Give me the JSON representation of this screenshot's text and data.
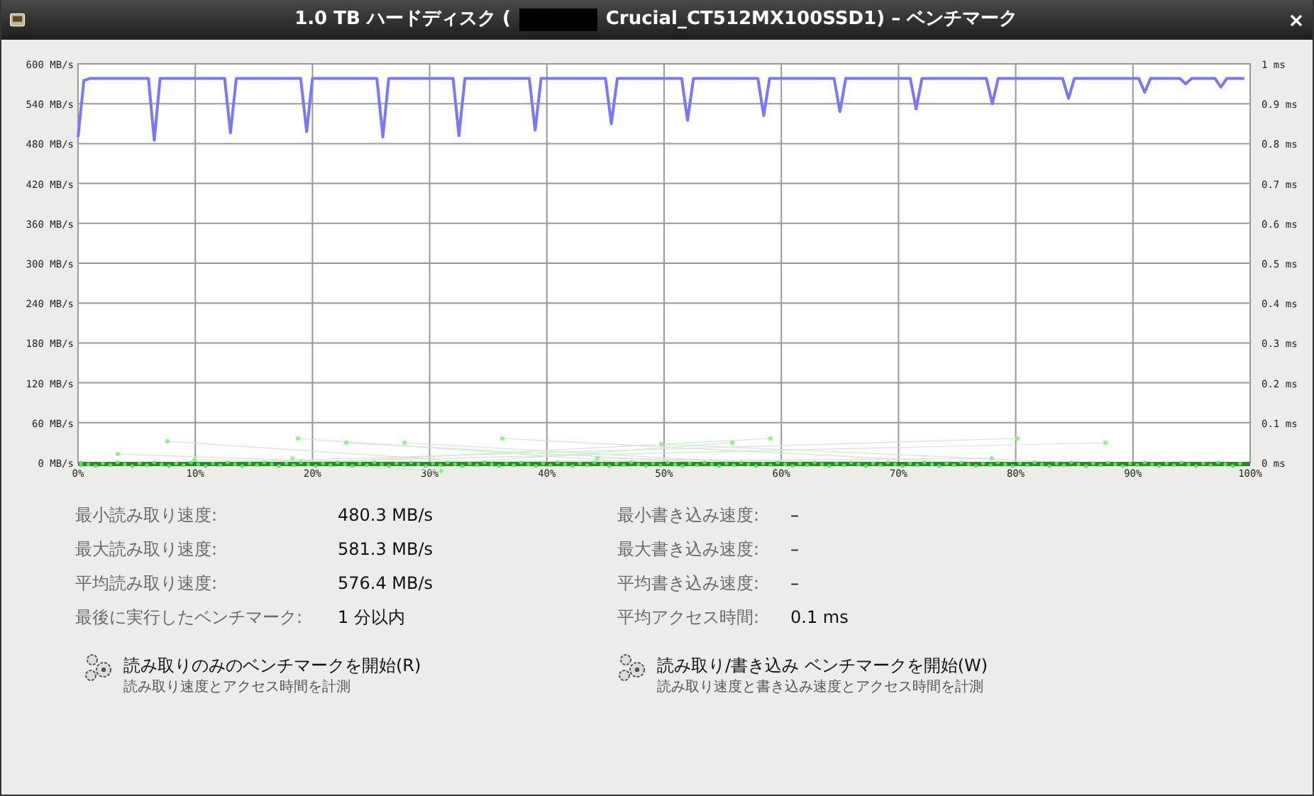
{
  "window": {
    "title_before": "1.0 TB ハードディスク (",
    "title_after": "Crucial_CT512MX100SSD1) – ベンチマーク"
  },
  "chart": {
    "right_axis_ticks": [
      "1 ms",
      "0.9 ms",
      "0.8 ms",
      "0.7 ms",
      "0.6 ms",
      "0.5 ms",
      "0.4 ms",
      "0.3 ms",
      "0.2 ms",
      "0.1 ms",
      "0 ms"
    ],
    "chart_data": {
      "type": "line",
      "grid": true,
      "xlim": [
        0,
        100
      ],
      "ylim": [
        0,
        600
      ],
      "xticks": [
        {
          "value": 0,
          "label": "0%"
        },
        {
          "value": 10,
          "label": "10%"
        },
        {
          "value": 20,
          "label": "20%"
        },
        {
          "value": 30,
          "label": "30%"
        },
        {
          "value": 40,
          "label": "40%"
        },
        {
          "value": 50,
          "label": "50%"
        },
        {
          "value": 60,
          "label": "60%"
        },
        {
          "value": 70,
          "label": "70%"
        },
        {
          "value": 80,
          "label": "80%"
        },
        {
          "value": 90,
          "label": "90%"
        },
        {
          "value": 100,
          "label": "100%"
        }
      ],
      "yticks": [
        {
          "value": 0,
          "label": "0 MB/s"
        },
        {
          "value": 60,
          "label": "60 MB/s"
        },
        {
          "value": 120,
          "label": "120 MB/s"
        },
        {
          "value": 180,
          "label": "180 MB/s"
        },
        {
          "value": 240,
          "label": "240 MB/s"
        },
        {
          "value": 300,
          "label": "300 MB/s"
        },
        {
          "value": 360,
          "label": "360 MB/s"
        },
        {
          "value": 420,
          "label": "420 MB/s"
        },
        {
          "value": 480,
          "label": "480 MB/s"
        },
        {
          "value": 540,
          "label": "540 MB/s"
        },
        {
          "value": 600,
          "label": "600 MB/s"
        }
      ],
      "x": [
        0,
        0.5,
        1,
        6,
        6.5,
        7,
        12.5,
        13,
        13.5,
        19,
        19.5,
        20,
        25.5,
        26,
        26.5,
        32,
        32.5,
        33,
        38.5,
        39,
        39.5,
        45,
        45.5,
        46,
        51.5,
        52,
        52.5,
        58,
        58.5,
        59,
        64.5,
        65,
        65.5,
        71,
        71.5,
        72,
        77.5,
        78,
        78.5,
        84,
        84.5,
        85,
        90.5,
        91,
        91.5,
        94,
        94.5,
        95,
        97,
        97.5,
        98,
        99.5
      ],
      "series": [
        {
          "color": "#7777ff",
          "values": [
            490,
            575,
            578,
            578,
            485,
            578,
            578,
            496,
            578,
            578,
            498,
            578,
            578,
            490,
            578,
            578,
            492,
            578,
            578,
            500,
            578,
            578,
            510,
            578,
            578,
            515,
            578,
            578,
            522,
            578,
            578,
            528,
            578,
            578,
            532,
            578,
            578,
            540,
            578,
            578,
            548,
            578,
            578,
            557,
            578,
            578,
            570,
            578,
            578,
            565,
            578,
            578
          ]
        }
      ]
    }
  },
  "stats_left": [
    {
      "label": "最小読み取り速度:",
      "value": "480.3 MB/s"
    },
    {
      "label": "最大読み取り速度:",
      "value": "581.3 MB/s"
    },
    {
      "label": "平均読み取り速度:",
      "value": "576.4 MB/s"
    },
    {
      "label": "最後に実行したベンチマーク:",
      "value": "1 分以内"
    }
  ],
  "stats_right": [
    {
      "label": "最小書き込み速度:",
      "value": "–"
    },
    {
      "label": "最大書き込み速度:",
      "value": "–"
    },
    {
      "label": "平均書き込み速度:",
      "value": "–"
    },
    {
      "label": "平均アクセス時間:",
      "value": "0.1 ms"
    }
  ],
  "actions": [
    {
      "title": "読み取りのみのベンチマークを開始(R)",
      "description": "読み取り速度とアクセス時間を計測"
    },
    {
      "title": "読み取り/書き込み ベンチマークを開始(W)",
      "description": "読み取り速度と書き込み速度とアクセス時間を計測"
    }
  ]
}
